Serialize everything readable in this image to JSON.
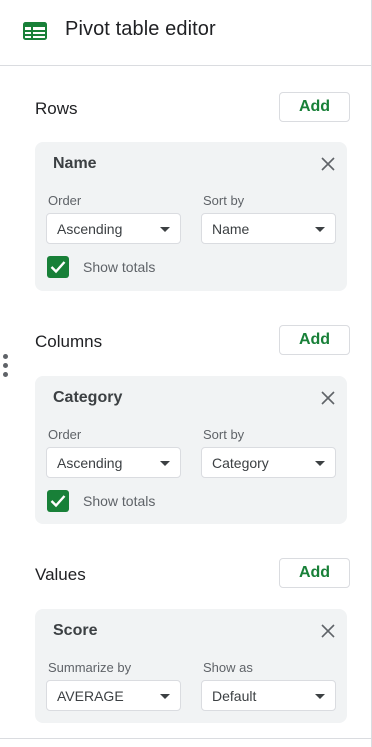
{
  "header": {
    "title": "Pivot table editor"
  },
  "rows": {
    "title": "Rows",
    "add_label": "Add",
    "card": {
      "name": "Name",
      "order_label": "Order",
      "order_value": "Ascending",
      "sort_label": "Sort by",
      "sort_value": "Name",
      "show_totals_label": "Show totals",
      "show_totals_checked": true
    }
  },
  "columns": {
    "title": "Columns",
    "add_label": "Add",
    "card": {
      "name": "Category",
      "order_label": "Order",
      "order_value": "Ascending",
      "sort_label": "Sort by",
      "sort_value": "Category",
      "show_totals_label": "Show totals",
      "show_totals_checked": true
    }
  },
  "values": {
    "title": "Values",
    "add_label": "Add",
    "card": {
      "name": "Score",
      "summarize_label": "Summarize by",
      "summarize_value": "AVERAGE",
      "show_as_label": "Show as",
      "show_as_value": "Default"
    }
  },
  "icons": {
    "sheet": "spreadsheet-icon",
    "close": "close-icon",
    "dropdown": "chevron-down-icon",
    "check": "check-icon",
    "drag": "drag-handle-icon"
  },
  "colors": {
    "accent_green": "#188038",
    "card_bg": "#f1f3f4",
    "border": "#dadce0"
  }
}
